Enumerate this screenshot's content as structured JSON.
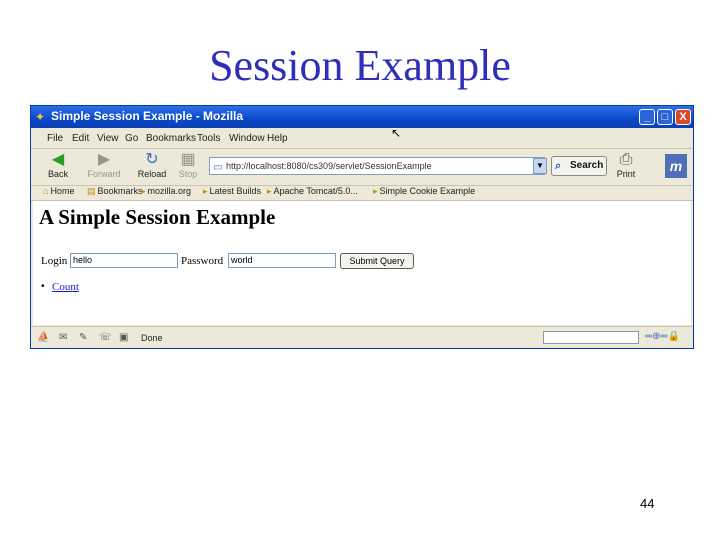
{
  "slide": {
    "title": "Session Example",
    "page_number": "44"
  },
  "window": {
    "title": "Simple Session Example - Mozilla",
    "controls": {
      "minimize": "_",
      "maximize": "□",
      "close": "X"
    }
  },
  "menu": [
    "File",
    "Edit",
    "View",
    "Go",
    "Bookmarks",
    "Tools",
    "Window",
    "Help"
  ],
  "toolbar": {
    "back": "Back",
    "forward": "Forward",
    "reload": "Reload",
    "stop": "Stop",
    "url": "http://localhost:8080/cs309/servlet/SessionExample",
    "search": "Search",
    "print": "Print"
  },
  "bookmarks": [
    "Home",
    "Bookmarks",
    "mozilla.org",
    "Latest Builds",
    "Apache Tomcat/5.0...",
    "Simple Cookie Example"
  ],
  "page": {
    "heading": "A Simple Session Example",
    "login_label": "Login",
    "login_value": "hello",
    "password_label": "Password",
    "password_value": "world",
    "submit_label": "Submit Query",
    "link_text": "Count"
  },
  "status": {
    "text": "Done"
  }
}
